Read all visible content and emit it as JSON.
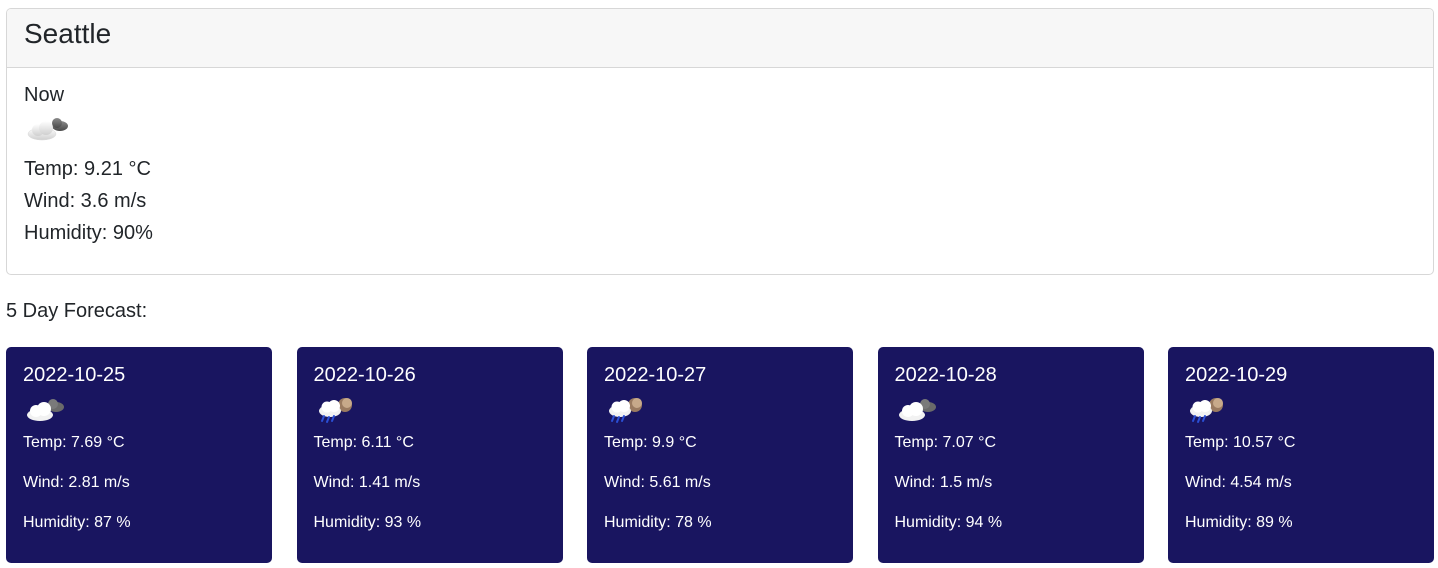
{
  "current": {
    "city": "Seattle",
    "now_label": "Now",
    "icon": "few-clouds-icon",
    "temp": "Temp: 9.21 °C",
    "wind": "Wind: 3.6 m/s",
    "humidity": "Humidity: 90%"
  },
  "forecast": {
    "title": "5 Day Forecast:",
    "card_color": "#191560",
    "days": [
      {
        "date": "2022-10-25",
        "icon": "cloudy-icon",
        "temp": "Temp: 7.69 °C",
        "wind": "Wind: 2.81 m/s",
        "humidity": "Humidity: 87 %"
      },
      {
        "date": "2022-10-26",
        "icon": "rain-night-icon",
        "temp": "Temp: 6.11 °C",
        "wind": "Wind: 1.41 m/s",
        "humidity": "Humidity: 93 %"
      },
      {
        "date": "2022-10-27",
        "icon": "rain-night-icon",
        "temp": "Temp: 9.9 °C",
        "wind": "Wind: 5.61 m/s",
        "humidity": "Humidity: 78 %"
      },
      {
        "date": "2022-10-28",
        "icon": "cloudy-icon",
        "temp": "Temp: 7.07 °C",
        "wind": "Wind: 1.5 m/s",
        "humidity": "Humidity: 94 %"
      },
      {
        "date": "2022-10-29",
        "icon": "rain-night-icon",
        "temp": "Temp: 10.57 °C",
        "wind": "Wind: 4.54 m/s",
        "humidity": "Humidity: 89 %"
      }
    ]
  }
}
